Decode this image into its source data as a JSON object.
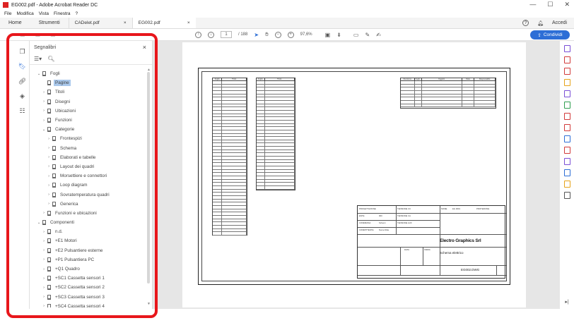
{
  "window": {
    "title": "EG002.pdf - Adobe Acrobat Reader DC",
    "controls": [
      "—",
      "☐",
      "✕"
    ]
  },
  "menu": [
    "File",
    "Modifica",
    "Vista",
    "Finestra",
    "?"
  ],
  "tabs": {
    "home": "Home",
    "tools": "Strumenti",
    "docs": [
      "CADelet.pdf",
      "EG002.pdf"
    ],
    "close": "×",
    "login": "Accedi"
  },
  "toolbar": {
    "page_current": "1",
    "page_total": "/ 188",
    "zoom": "97,6%",
    "share": "Condividi"
  },
  "panel": {
    "title": "Segnalibri",
    "close": "×"
  },
  "tree": [
    {
      "level": 0,
      "chev": "⌄",
      "label": "Fogli"
    },
    {
      "level": 1,
      "chev": "",
      "label": "Pagine",
      "selected": true
    },
    {
      "level": 1,
      "chev": "›",
      "label": "Titoli"
    },
    {
      "level": 1,
      "chev": "›",
      "label": "Disegni"
    },
    {
      "level": 1,
      "chev": "›",
      "label": "Ubicazioni"
    },
    {
      "level": 1,
      "chev": "›",
      "label": "Funzioni"
    },
    {
      "level": 1,
      "chev": "⌄",
      "label": "Categorie"
    },
    {
      "level": 2,
      "chev": "›",
      "label": "Frontespizi"
    },
    {
      "level": 2,
      "chev": "›",
      "label": "Schema"
    },
    {
      "level": 2,
      "chev": "›",
      "label": "Elaborati e tabelle"
    },
    {
      "level": 2,
      "chev": "›",
      "label": "Layout dei quadri"
    },
    {
      "level": 2,
      "chev": "›",
      "label": "Morsettiere e connettori"
    },
    {
      "level": 2,
      "chev": "›",
      "label": "Loop diagram"
    },
    {
      "level": 2,
      "chev": "›",
      "label": "Sovratemperatura quadri"
    },
    {
      "level": 2,
      "chev": "›",
      "label": "Generica"
    },
    {
      "level": 1,
      "chev": "›",
      "label": "Funzioni e ubicazioni"
    },
    {
      "level": 0,
      "chev": "⌄",
      "label": "Componenti"
    },
    {
      "level": 1,
      "chev": "›",
      "label": "n.d."
    },
    {
      "level": 1,
      "chev": "›",
      "label": "+E1 Motori"
    },
    {
      "level": 1,
      "chev": "›",
      "label": "+E2 Pulsantiere esterne"
    },
    {
      "level": 1,
      "chev": "›",
      "label": "+P1 Pulsantiera PC"
    },
    {
      "level": 1,
      "chev": "›",
      "label": "+Q1 Quadro"
    },
    {
      "level": 1,
      "chev": "›",
      "label": "+SC1 Cassetta sensori 1"
    },
    {
      "level": 1,
      "chev": "›",
      "label": "+SC2 Cassetta sensori 2"
    },
    {
      "level": 1,
      "chev": "›",
      "label": "+SC3 Cassetta sensori 3"
    },
    {
      "level": 1,
      "chev": "›",
      "label": "+SC4 Cassetta sensori 4"
    }
  ],
  "document": {
    "table1_headers": [
      "Foglio",
      "Titolo"
    ],
    "table2_headers": [
      "Foglio",
      "Titolo"
    ],
    "table3_headers": [
      "Revisione",
      "Foglio",
      "Oggetto",
      "Data",
      "Responsabile"
    ],
    "company": "Electro Graphics Srl",
    "subtitle": "Schema elettrico",
    "drawing_code": "EG002.DWG",
    "labels": {
      "progettazione": "PROGETTAZIONE",
      "ente": "ENTE",
      "commessa": "COMMESSA",
      "committente": "COMMITTENTE",
      "tensione_cc": "TENSIONE CC",
      "tensione_ca": "TENSIONE CA",
      "tensione_aux": "TENSIONE AUX",
      "nome": "NOME",
      "protezione": "PROTEZIONE",
      "data": "DATA",
      "firma": "FIRMA"
    },
    "values": {
      "ente": "000",
      "commessa": "Schemi",
      "committente": "Nome Ditta",
      "nome": "EG 0001"
    }
  },
  "colors": {
    "highlight": "#e8161b",
    "accent": "#2d6ed6",
    "selection": "#a9c8ec"
  }
}
